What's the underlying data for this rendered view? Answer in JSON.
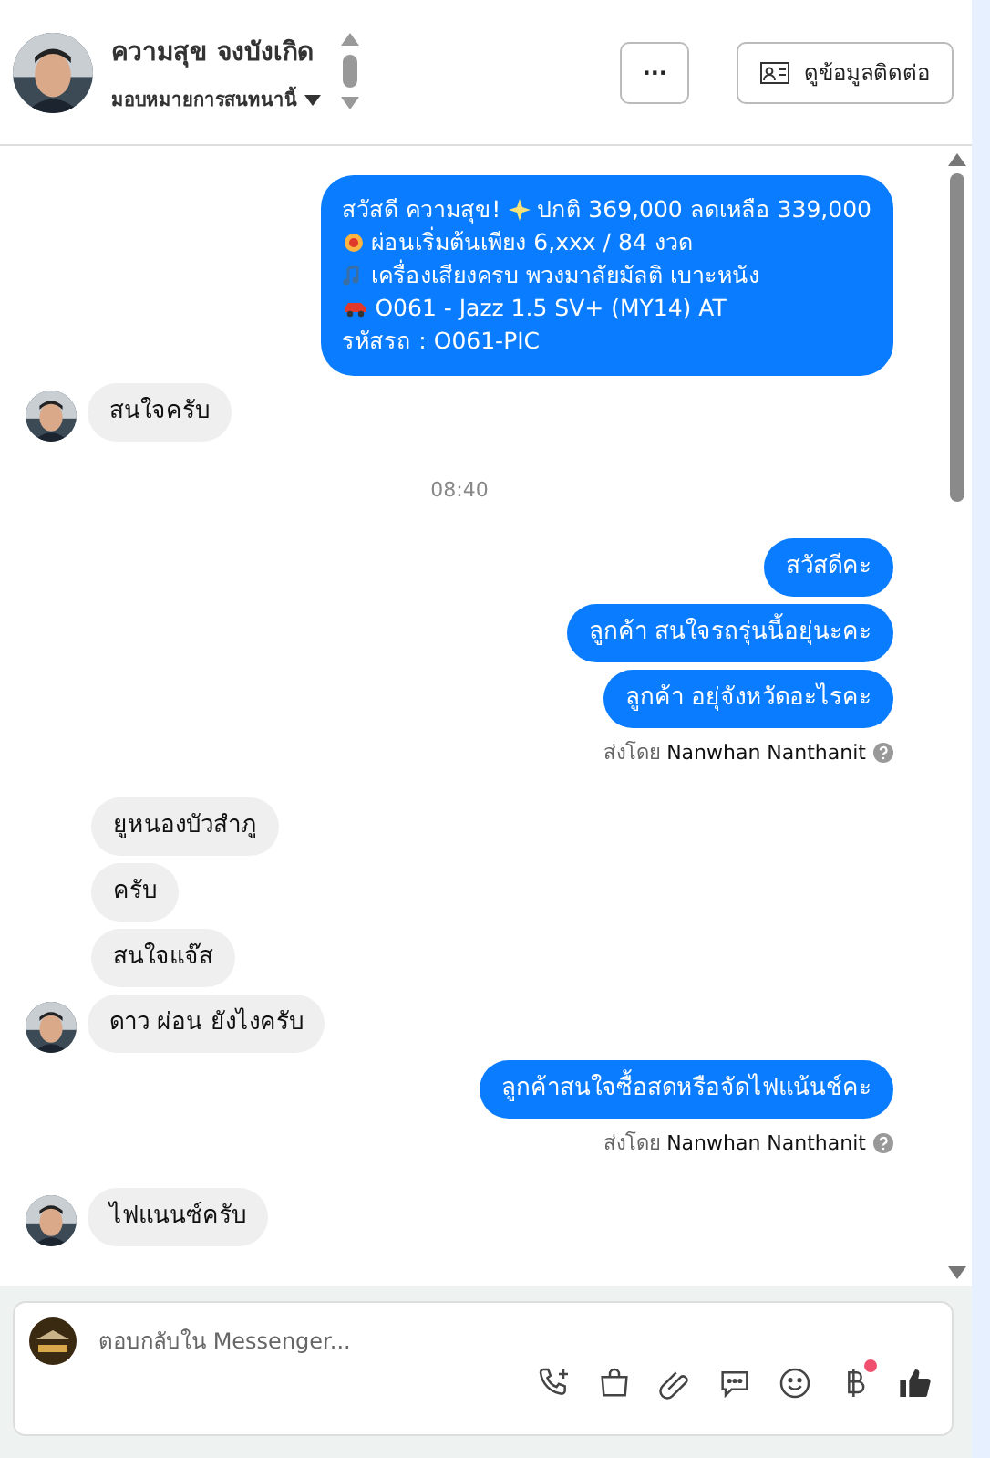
{
  "header": {
    "name": "ความสุข จงบังเกิด",
    "assign": "มอบหมายการสนทนานี้",
    "more_button": "···",
    "contact_button": "ดูข้อมูลติดต่อ"
  },
  "messages": [
    {
      "kind": "outgoing",
      "lines": [
        {
          "kind": "plain",
          "text": "สวัสดี ความสุข! "
        },
        {
          "kind": "burst",
          "text": "ผ่อนเริ่มต้นเพียง 6,xxx / 84 งวด"
        },
        {
          "kind": "music",
          "text": "เครื่องเสียงครบ พวงมาลัยมัลติ เบาะหนัง"
        },
        {
          "kind": "car",
          "text": "O061 - Jazz 1.5 SV+ (MY14) AT"
        },
        {
          "kind": "plain",
          "text": "รหัสรถ : O061-PIC"
        }
      ],
      "first_tail": "ปกติ 369,000 ลดเหลือ 339,000"
    },
    {
      "kind": "incoming",
      "avatar": true,
      "text": "สนใจครับ"
    },
    {
      "kind": "time",
      "text": "08:40"
    },
    {
      "kind": "outgoing",
      "text": "สวัสดีคะ"
    },
    {
      "kind": "outgoing",
      "text": "ลูกค้า สนใจรถรุ่นนี้อยุ่นะคะ"
    },
    {
      "kind": "outgoing",
      "text": "ลูกค้า อยุ่จังหวัดอะไรคะ"
    },
    {
      "kind": "sent_by",
      "text": "ส่งโดย **Nanwhan Nanthanit**"
    },
    {
      "kind": "incoming",
      "avatar": false,
      "text": "ยูหนองบัวสำภู"
    },
    {
      "kind": "incoming",
      "avatar": false,
      "text": "ครับ"
    },
    {
      "kind": "incoming",
      "avatar": false,
      "text": "สนใจแจ๊ส"
    },
    {
      "kind": "incoming",
      "avatar": true,
      "text": "ดาว ผ่อน ยังไงครับ"
    },
    {
      "kind": "outgoing",
      "text": "ลูกค้าสนใจซื้อสดหรือจัดไฟแน้นช์คะ"
    },
    {
      "kind": "sent_by",
      "text": "ส่งโดย **Nanwhan Nanthanit**"
    },
    {
      "kind": "incoming",
      "avatar": true,
      "text": "ไฟแนนซ์ครับ"
    }
  ],
  "composer": {
    "placeholder": "ตอบกลับใน Messenger...",
    "tools": [
      {
        "kind": "call",
        "badge": false
      },
      {
        "kind": "bag",
        "badge": false
      },
      {
        "kind": "clip",
        "badge": false
      },
      {
        "kind": "chat",
        "badge": false
      },
      {
        "kind": "smile",
        "badge": false
      },
      {
        "kind": "baht",
        "badge": true
      },
      {
        "kind": "like",
        "badge": false
      }
    ]
  }
}
